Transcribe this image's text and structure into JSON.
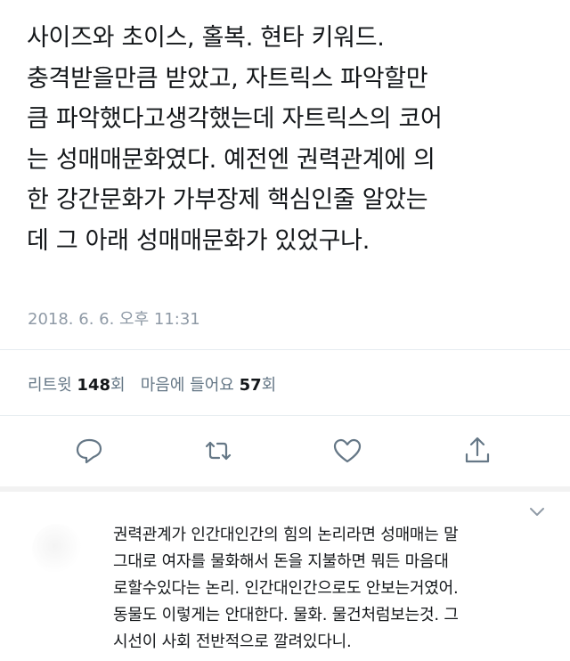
{
  "tweet": {
    "lines": [
      "사이즈와 초이스, 홀복. 현타 키워드.",
      "충격받을만큼 받았고, 자트릭스 파악할만",
      "큼 파악했다고생각했는데 자트릭스의 코어",
      "는 성매매문화였다. 예전엔 권력관계에 의",
      "한 강간문화가 가부장제 핵심인줄 알았는",
      "데 그 아래 성매매문화가 있었구나."
    ],
    "timestamp": "2018. 6. 6. 오후 11:31"
  },
  "stats": {
    "retweet_label": "리트윗",
    "retweet_count": "148",
    "retweet_unit": "회",
    "like_label": "마음에 들어요",
    "like_count": "57",
    "like_unit": "회"
  },
  "actions": {
    "icons": [
      "reply-icon",
      "retweet-icon",
      "like-icon",
      "share-icon"
    ],
    "icon_color": "#657786"
  },
  "reply": {
    "lines": [
      "권력관계가 인간대인간의 힘의 논리라면 성매매는 말",
      "그대로 여자를 물화해서 돈을 지불하면 뭐든 마음대",
      "로할수있다는 논리. 인간대인간으로도 안보는거였어.",
      "동물도 이렇게는 안대한다. 물화. 물건처럼보는것. 그",
      "시선이 사회 전반적으로 깔려있다니."
    ]
  }
}
